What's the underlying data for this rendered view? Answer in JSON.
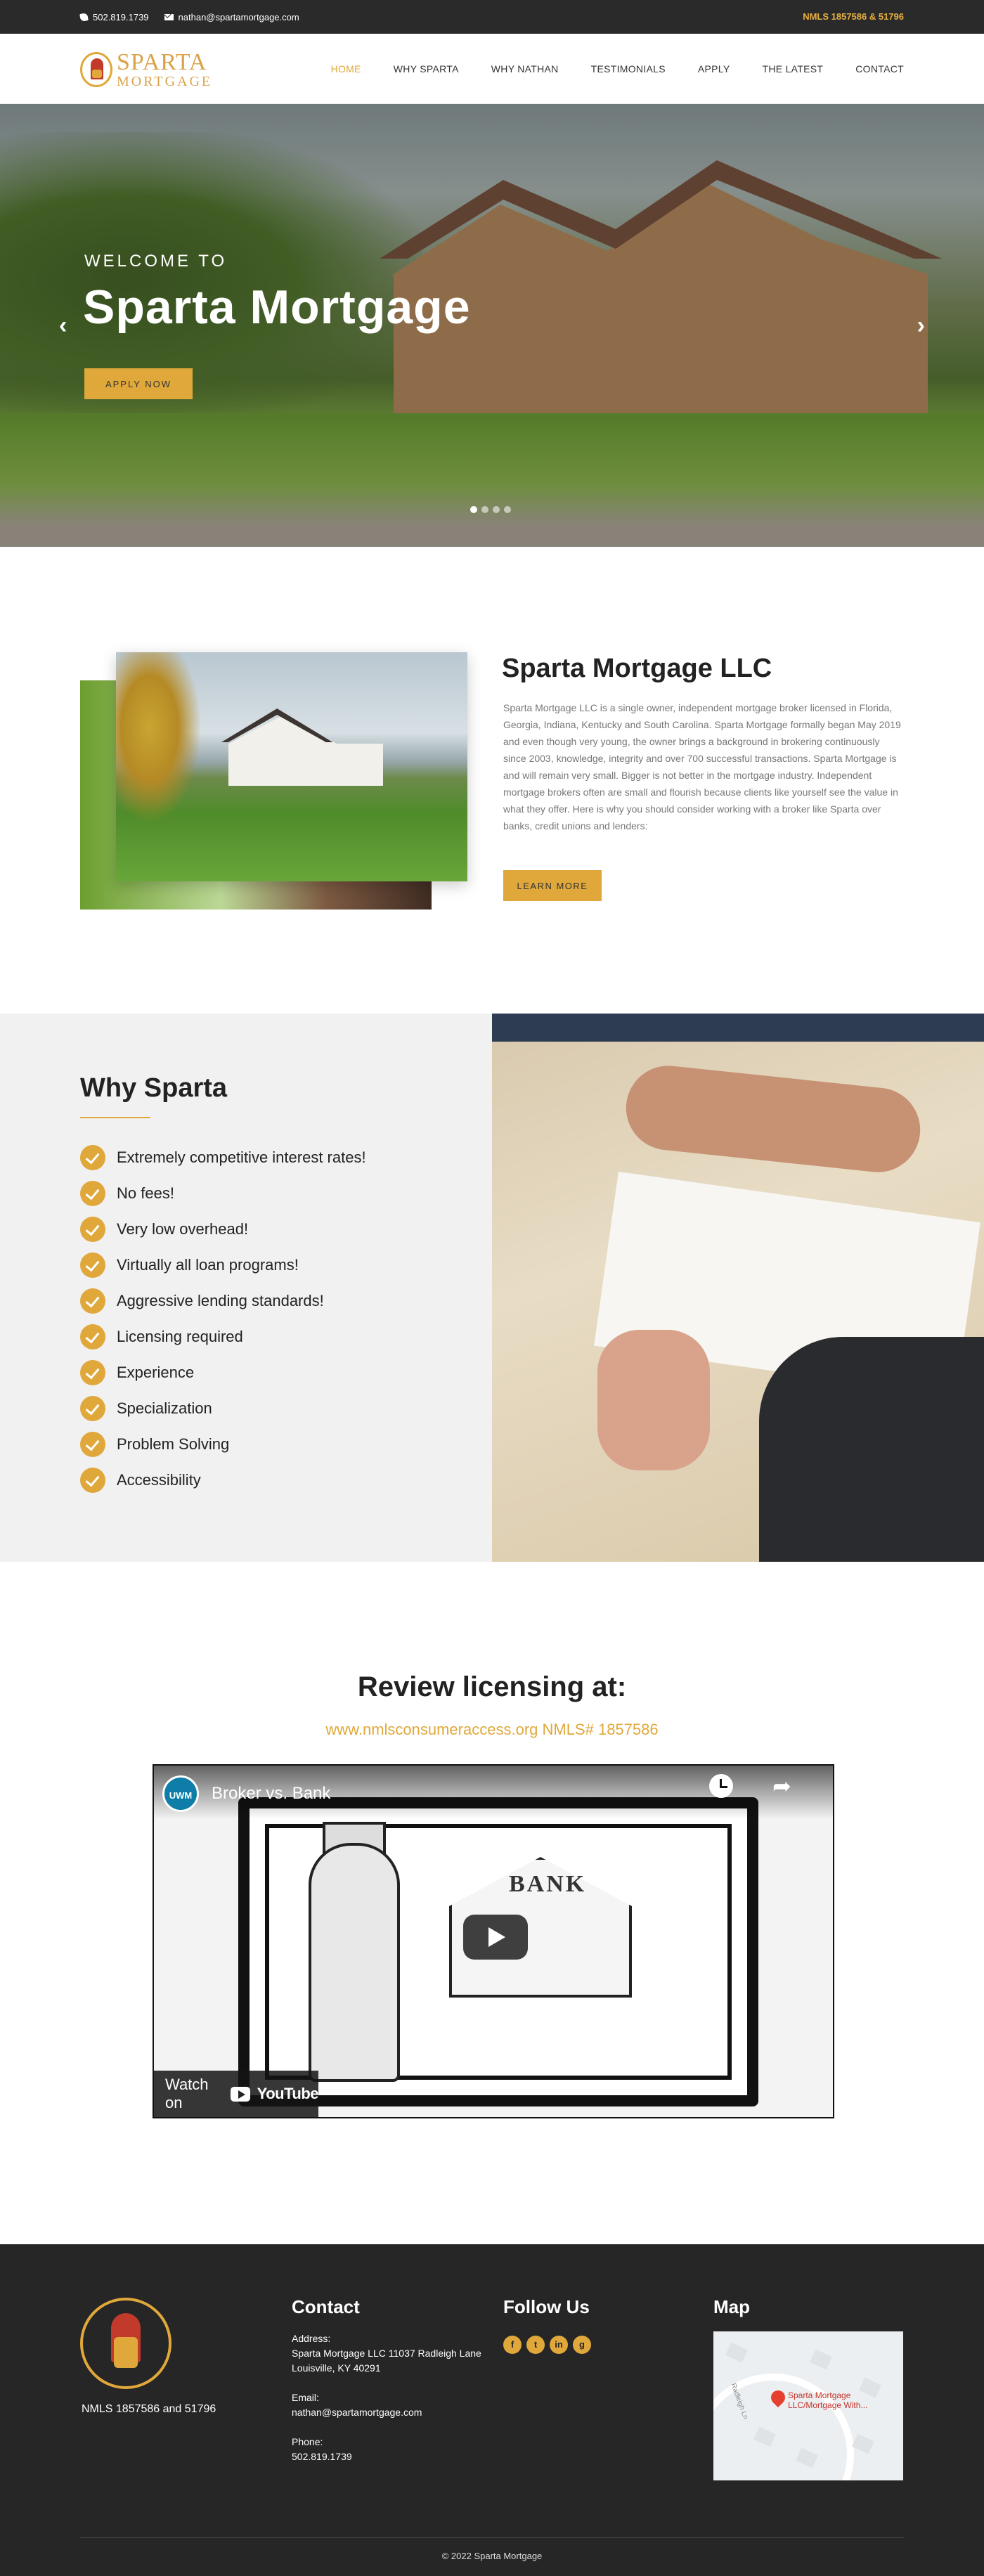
{
  "topbar": {
    "phone": "502.819.1739",
    "email": "nathan@spartamortgage.com",
    "nmls": "NMLS 1857586 & 51796"
  },
  "header": {
    "logo_line1": "SPARTA",
    "logo_line2": "MORTGAGE",
    "nav": [
      "HOME",
      "WHY SPARTA",
      "WHY NATHAN",
      "TESTIMONIALS",
      "APPLY",
      "THE LATEST",
      "CONTACT"
    ],
    "active_nav": "HOME"
  },
  "hero": {
    "welcome": "WELCOME TO",
    "title": "Sparta Mortgage",
    "button": "APPLY NOW",
    "prev_icon": "‹",
    "next_icon": "›",
    "slides": 4,
    "active_slide": 1
  },
  "about": {
    "title": "Sparta Mortgage LLC",
    "body": "Sparta Mortgage LLC is a single owner, independent mortgage broker licensed in Florida, Georgia, Indiana, Kentucky and South Carolina. Sparta Mortgage formally began May 2019 and even though very young, the owner brings a background in brokering continuously since 2003, knowledge, integrity and over 700 successful transactions. Sparta Mortgage is and will remain very small. Bigger is not better in the mortgage industry. Independent mortgage brokers often are small and flourish because clients like yourself see the value in what they offer. Here is why you should consider working with a broker like Sparta over banks, credit unions and lenders:",
    "button": "LEARN MORE"
  },
  "why": {
    "title": "Why Sparta",
    "items": [
      "Extremely competitive interest rates!",
      "No fees!",
      "Very low overhead!",
      "Virtually all loan programs!",
      "Aggressive lending standards!",
      "Licensing required",
      "Experience",
      "Specialization",
      "Problem Solving",
      "Accessibility"
    ]
  },
  "review": {
    "title": "Review licensing at:",
    "link": "www.nmlsconsumeraccess.org NMLS# 1857586",
    "video": {
      "channel": "UWM",
      "title": "Broker vs. Bank",
      "bank_sign": "BANK",
      "watch_on": "Watch on",
      "youtube": "YouTube"
    }
  },
  "footer": {
    "nmls": "NMLS 1857586 and 51796",
    "contact_title": "Contact",
    "address_label": "Address:",
    "address": "Sparta Mortgage LLC 11037 Radleigh Lane Louisville, KY 40291",
    "email_label": "Email:",
    "email": "nathan@spartamortgage.com",
    "phone_label": "Phone:",
    "phone": "502.819.1739",
    "follow_title": "Follow Us",
    "social": [
      "f",
      "t",
      "in",
      "g"
    ],
    "map_title": "Map",
    "map_pin_label": "Sparta Mortgage LLC/Mortgage With...",
    "map_road_label": "Radleigh Ln",
    "copyright": "© 2022 Sparta Mortgage"
  },
  "colors": {
    "accent": "#e0a83a",
    "dark": "#262626"
  }
}
